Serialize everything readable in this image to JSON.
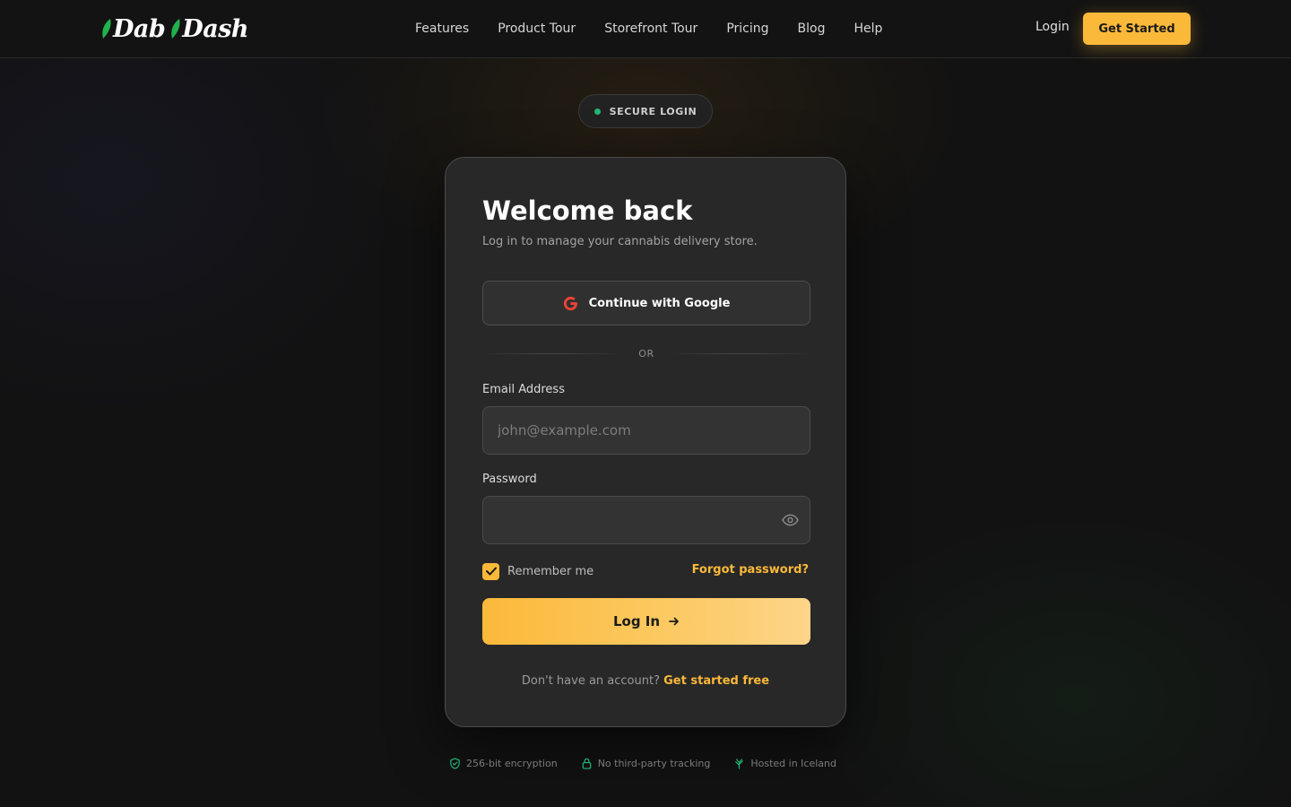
{
  "brand": {
    "name_part1": "Dab",
    "name_part2": "Dash",
    "leaf_color": "#22b14c"
  },
  "nav": {
    "items": [
      {
        "id": "features",
        "label": "Features"
      },
      {
        "id": "product-tour",
        "label": "Product Tour"
      },
      {
        "id": "storefront-tour",
        "label": "Storefront Tour"
      },
      {
        "id": "pricing",
        "label": "Pricing"
      },
      {
        "id": "blog",
        "label": "Blog"
      },
      {
        "id": "help",
        "label": "Help"
      }
    ],
    "login_label": "Login",
    "get_started_label": "Get Started"
  },
  "badge": {
    "label": "SECURE LOGIN",
    "dot_color": "#22b673"
  },
  "card": {
    "title": "Welcome back",
    "subtitle": "Log in to manage your cannabis delivery store.",
    "google_button_label": "Continue with Google",
    "divider_label": "OR",
    "email": {
      "label": "Email Address",
      "placeholder": "john@example.com",
      "value": ""
    },
    "password": {
      "label": "Password",
      "placeholder": "",
      "value": ""
    },
    "remember_me": {
      "label": "Remember me",
      "checked": true
    },
    "forgot_password_label": "Forgot password?",
    "login_button_label": "Log In",
    "signup_prompt": "Don't have an account?",
    "signup_link_label": "Get started free"
  },
  "trust": {
    "items": [
      {
        "icon": "shield-check-icon",
        "label": "256-bit encryption"
      },
      {
        "icon": "lock-icon",
        "label": "No third-party tracking"
      },
      {
        "icon": "leaf-icon",
        "label": "Hosted in Iceland"
      }
    ],
    "icon_color": "#22b673"
  },
  "colors": {
    "accent": "#fbb93a",
    "background": "#121212",
    "card": "#282828"
  }
}
